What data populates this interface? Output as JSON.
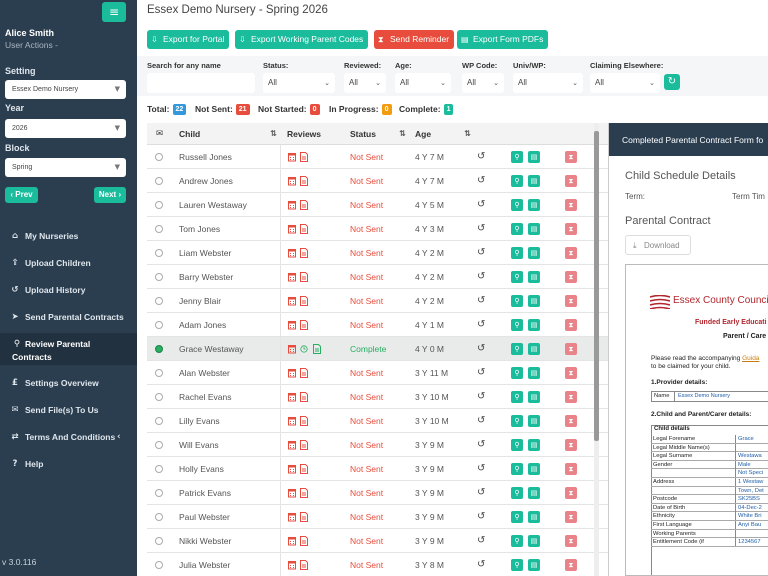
{
  "sidebar": {
    "menu_icon": "≡",
    "user_name": "Alice Smith",
    "user_actions": "User Actions -",
    "setting_label": "Setting",
    "setting_value": "Essex Demo Nursery",
    "year_label": "Year",
    "year_value": "2026",
    "block_label": "Block",
    "block_value": "Spring",
    "prev_label": "‹ Prev",
    "next_label": "Next ›",
    "nav": [
      {
        "label": "My Nurseries",
        "icon": "⌂"
      },
      {
        "label": "Upload Children",
        "icon": "⇪"
      },
      {
        "label": "Upload History",
        "icon": "↺"
      },
      {
        "label": "Send Parental Contracts",
        "icon": "➤"
      },
      {
        "label": "Review Parental",
        "label2": "Contracts",
        "icon": "⚲"
      },
      {
        "label": "Settings Overview",
        "icon": "£"
      },
      {
        "label": "Send File(s) To Us",
        "icon": "✉"
      },
      {
        "label": "Terms And Conditions",
        "icon": "⇄",
        "chevron": "‹"
      },
      {
        "label": "Help",
        "icon": "?"
      }
    ],
    "version": "v 3.0.116"
  },
  "header": {
    "title": "Essex Demo Nursery - Spring 2026"
  },
  "toolbar": {
    "export_portal": "Export for Portal",
    "export_working": "Export Working Parent Codes",
    "send_reminder": "Send Reminder",
    "export_pdfs": "Export Form PDFs"
  },
  "filters": {
    "search_label": "Search for any name",
    "search_value": "",
    "status_label": "Status:",
    "status_value": "All",
    "reviewed_label": "Reviewed:",
    "reviewed_value": "All",
    "age_label": "Age:",
    "age_value": "All",
    "wp_label": "WP Code:",
    "wp_value": "All",
    "univ_label": "Univ/WP:",
    "univ_value": "All",
    "claiming_label": "Claiming Elsewhere:",
    "claiming_value": "All"
  },
  "stats": {
    "total_label": "Total:",
    "total": "22",
    "not_sent_label": "Not Sent:",
    "not_sent": "21",
    "not_started_label": "Not Started:",
    "not_started": "0",
    "in_progress_label": "In Progress:",
    "in_progress": "0",
    "complete_label": "Complete:",
    "complete": "1",
    "colors": {
      "total": "#3498db",
      "not_sent": "#e74c3c",
      "not_started": "#e74c3c",
      "in_progress": "#f39c12",
      "complete": "#1abc9c"
    }
  },
  "table": {
    "columns": {
      "child": "Child",
      "reviews": "Reviews",
      "status": "Status",
      "age": "Age"
    },
    "rows": [
      {
        "name": "Russell Jones",
        "status": "Not Sent",
        "age": "4 Y 7 M"
      },
      {
        "name": "Andrew Jones",
        "status": "Not Sent",
        "age": "4 Y 7 M"
      },
      {
        "name": "Lauren Westaway",
        "status": "Not Sent",
        "age": "4 Y 5 M"
      },
      {
        "name": "Tom Jones",
        "status": "Not Sent",
        "age": "4 Y 3 M"
      },
      {
        "name": "Liam Webster",
        "status": "Not Sent",
        "age": "4 Y 2 M"
      },
      {
        "name": "Barry Webster",
        "status": "Not Sent",
        "age": "4 Y 2 M"
      },
      {
        "name": "Jenny Blair",
        "status": "Not Sent",
        "age": "4 Y 2 M"
      },
      {
        "name": "Adam Jones",
        "status": "Not Sent",
        "age": "4 Y 1 M"
      },
      {
        "name": "Grace Westaway",
        "status": "Complete",
        "age": "4 Y 0 M",
        "selected": true
      },
      {
        "name": "Alan Webster",
        "status": "Not Sent",
        "age": "3 Y 11 M"
      },
      {
        "name": "Rachel Evans",
        "status": "Not Sent",
        "age": "3 Y 10 M"
      },
      {
        "name": "Lilly Evans",
        "status": "Not Sent",
        "age": "3 Y 10 M"
      },
      {
        "name": "Will Evans",
        "status": "Not Sent",
        "age": "3 Y 9 M"
      },
      {
        "name": "Holly Evans",
        "status": "Not Sent",
        "age": "3 Y 9 M"
      },
      {
        "name": "Patrick Evans",
        "status": "Not Sent",
        "age": "3 Y 9 M"
      },
      {
        "name": "Paul Webster",
        "status": "Not Sent",
        "age": "3 Y 9 M"
      },
      {
        "name": "Nikki Webster",
        "status": "Not Sent",
        "age": "3 Y 9 M"
      },
      {
        "name": "Julia Webster",
        "status": "Not Sent",
        "age": "3 Y 8 M"
      }
    ]
  },
  "panel": {
    "header": "Completed Parental Contract Form fo",
    "schedule_title": "Child Schedule Details",
    "term_label": "Term:",
    "term_time_label": "Term Tim",
    "contract_title": "Parental Contract",
    "download_label": "Download",
    "pdf": {
      "council": "Essex County Counci",
      "funded": "Funded Early Educati",
      "parent_care": "Parent / Care",
      "please_read": "Please read the accompanying",
      "guide_link": "Guida",
      "to_be_claimed": "to be claimed for your child.",
      "provider_heading": "1.Provider details:",
      "provider_name_label": "Name",
      "provider_name_value": "Essex Demo Nursery",
      "child_heading": "2.Child and Parent/Carer details:",
      "child_details_label": "Child details",
      "fields": [
        {
          "label": "Legal Forename",
          "value": "Grace"
        },
        {
          "label": "Legal Middle Name(s)",
          "value": ""
        },
        {
          "label": "Legal Surname",
          "value": "Westawa"
        },
        {
          "label": "Gender",
          "value": "Male"
        },
        {
          "label": "",
          "value": "Not Speci"
        },
        {
          "label": "Address",
          "value": "1 Westaw"
        },
        {
          "label": "",
          "value": "Town, Det"
        },
        {
          "label": "Postcode",
          "value": "SK25BS"
        },
        {
          "label": "Date of Birth",
          "value": "04-Dec-2"
        },
        {
          "label": "Ethnicity",
          "value": "White Bri"
        },
        {
          "label": "First Language",
          "value": "Anyi Bau"
        },
        {
          "label": "Working Parents",
          "value": ""
        },
        {
          "label": "Entitlement Code (if",
          "value": "1234567"
        }
      ]
    }
  }
}
